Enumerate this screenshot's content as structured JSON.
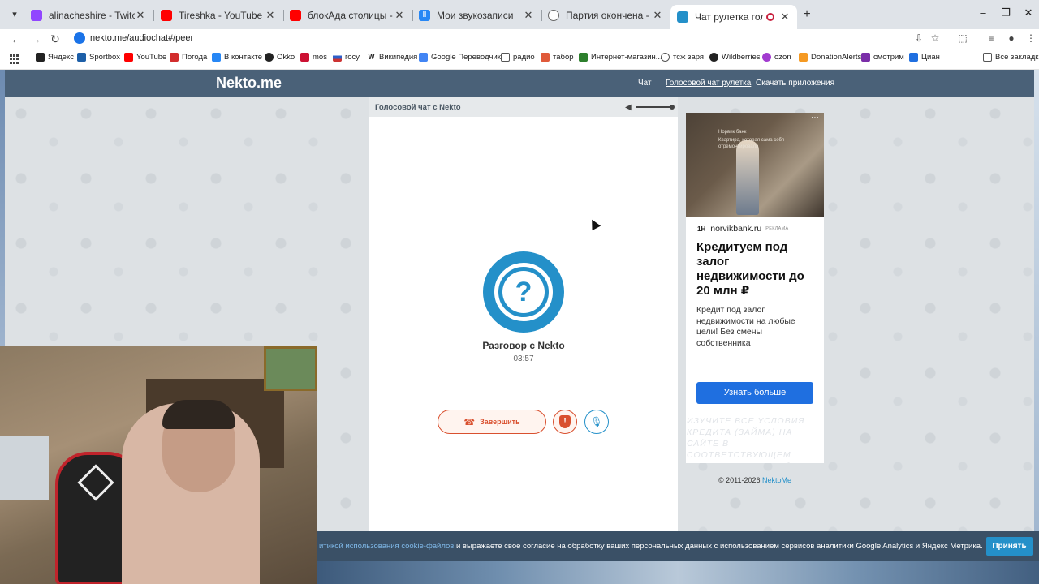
{
  "browser": {
    "tabs": [
      {
        "title": "alinacheshire - Twitch",
        "icon_color": "#9146ff"
      },
      {
        "title": "Tireshka - YouTube",
        "icon_color": "#ff0000"
      },
      {
        "title": "блокАда столицы - YouTube",
        "icon_color": "#ff0000"
      },
      {
        "title": "Мои звукозаписи",
        "icon_color": "#2787f5"
      },
      {
        "title": "Партия окончена - Игра iguan",
        "icon_color": "#666666"
      },
      {
        "title": "Чат рулетка голосовая — I",
        "icon_color": "#2490c9"
      }
    ],
    "url": "nekto.me/audiochat#/peer",
    "bookmarks": [
      {
        "label": "Яндекс",
        "icon_color": "#222222"
      },
      {
        "label": "Sportbox",
        "icon_color": "#1d5fa8"
      },
      {
        "label": "YouTube",
        "icon_color": "#ff0000"
      },
      {
        "label": "Погода",
        "icon_color": "#d22d2d"
      },
      {
        "label": "В контакте",
        "icon_color": "#2787f5"
      },
      {
        "label": "Okko",
        "icon_color": "#222222"
      },
      {
        "label": "mos",
        "icon_color": "#cc1133"
      },
      {
        "label": "госу",
        "icon_color": "#cc3333"
      },
      {
        "label": "Википедия",
        "icon_color": "#222222"
      },
      {
        "label": "Google Переводчик",
        "icon_color": "#4285f4"
      },
      {
        "label": "радио",
        "icon_color": "#555555"
      },
      {
        "label": "табор",
        "icon_color": "#e05a3a"
      },
      {
        "label": "Интернет-магазин...",
        "icon_color": "#2d7f2d"
      },
      {
        "label": "тсж заря",
        "icon_color": "#555555"
      },
      {
        "label": "Wildberries",
        "icon_color": "#222222"
      },
      {
        "label": "ozon",
        "icon_color": "#a23bd0"
      },
      {
        "label": "DonationAlerts",
        "icon_color": "#f59a23"
      },
      {
        "label": "смотрим",
        "icon_color": "#7a2ea8"
      },
      {
        "label": "Циан",
        "icon_color": "#1f6fe0"
      }
    ],
    "all_bookmarks": "Все закладки"
  },
  "site": {
    "logo": "Nekto.me",
    "nav": [
      "Чат",
      "Голосовой чат рулетка",
      "Скачать приложения"
    ],
    "panel_title": "Голосовой чат с Nekto",
    "avatar_symbol": "?",
    "talk_title": "Разговор с Nekto",
    "talk_time": "03:57",
    "end_button": "Завершить",
    "accent": "#2490c9",
    "danger": "#d9502f",
    "copyright": "© 2011-2026",
    "copyright_link": "NektoMe"
  },
  "ad": {
    "brand": "Норвик банк",
    "tagline": "Квартира, которая сама себя отремонтировала",
    "domain_mark": "1H",
    "domain": "norvikbank.ru",
    "ad_label": "РЕКЛАМА",
    "headline": "Кредитуем под залог недвижимости до 20 млн ₽",
    "body": "Кредит под залог недвижимости на любые цели! Без смены собственника",
    "cta": "Узнать больше",
    "disclaimer": "Изучите все условия кредита (займа) на сайте в соответствующем разделе. Оценивайте свои финансовые возможности и риски"
  },
  "cookie": {
    "link_text": "итикой использования cookie-файлов",
    "text": " и выражаете свое согласие на обработку ваших персональных данных с использованием сервисов аналитики Google Analytics и Яндекс Метрика.",
    "accept": "Принять"
  }
}
